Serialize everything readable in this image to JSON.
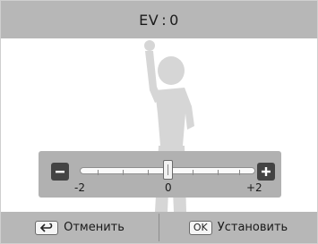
{
  "header": {
    "title_label": "EV",
    "title_separator": ":",
    "ev_value": "0"
  },
  "ev_slider": {
    "min_label": "-2",
    "mid_label": "0",
    "max_label": "+2",
    "minus_icon": "minus-icon",
    "plus_icon": "plus-icon",
    "current_value": 0,
    "range": [
      -2,
      2
    ]
  },
  "footer": {
    "cancel_key_icon": "back-arrow-icon",
    "cancel_label": "Отменить",
    "ok_key_label": "OK",
    "set_label": "Установить"
  },
  "colors": {
    "bar": "#b7b7b7",
    "panel": "#b1b1b1",
    "silhouette": "#d6d6d6"
  }
}
